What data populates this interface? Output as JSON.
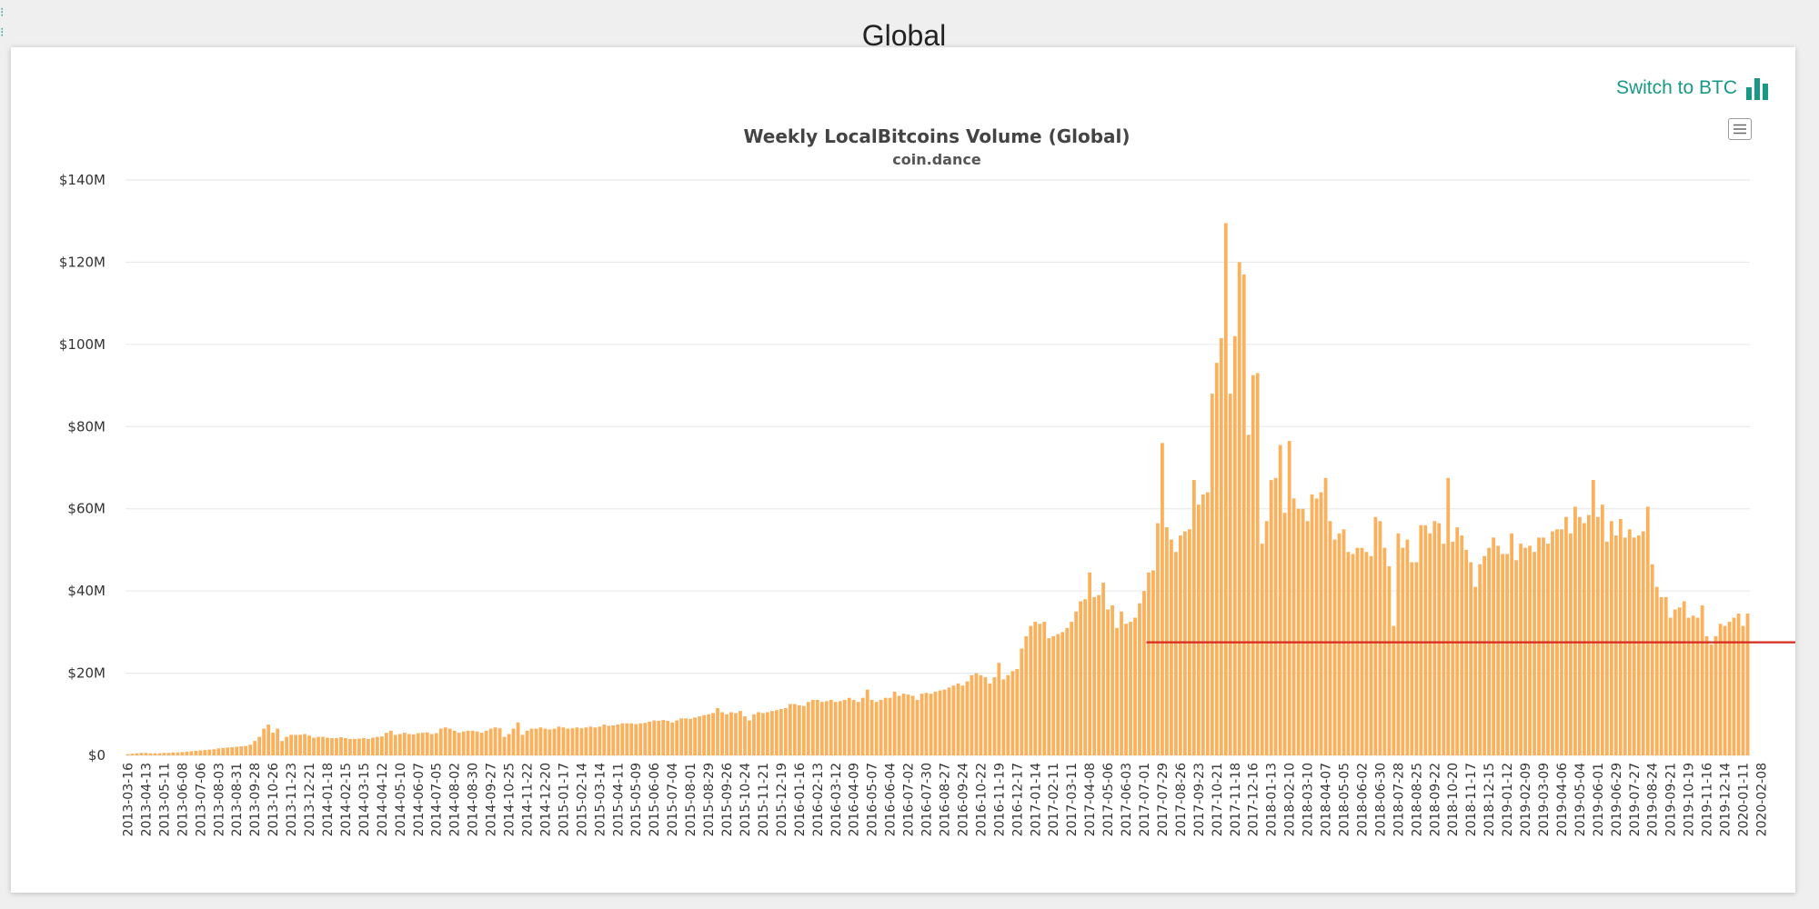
{
  "page": {
    "title": "Global"
  },
  "toolbar": {
    "switch_label": "Switch to BTC",
    "switch_icon": "bar-chart-icon",
    "menu_icon": "hamburger-menu-icon"
  },
  "colors": {
    "bars": "#fbb15c",
    "average_line": "#d62a1e",
    "accent": "#199985",
    "grid": "#e6e6e6"
  },
  "chart_data": {
    "type": "bar",
    "title": "Weekly LocalBitcoins Volume (Global)",
    "subtitle": "coin.dance",
    "xlabel": "",
    "ylabel": "",
    "ylim": [
      0,
      140
    ],
    "y_unit": "million USD",
    "y_ticks": [
      "$0",
      "$20M",
      "$40M",
      "$60M",
      "$80M",
      "$100M",
      "$120M",
      "$140M"
    ],
    "grid": true,
    "x_tick_labels": [
      "2013-03-16",
      "2013-04-13",
      "2013-05-11",
      "2013-06-08",
      "2013-07-06",
      "2013-08-03",
      "2013-08-31",
      "2013-09-28",
      "2013-10-26",
      "2013-11-23",
      "2013-12-21",
      "2014-01-18",
      "2014-02-15",
      "2014-03-15",
      "2014-04-12",
      "2014-05-10",
      "2014-06-07",
      "2014-07-05",
      "2014-08-02",
      "2014-08-30",
      "2014-09-27",
      "2014-10-25",
      "2014-11-22",
      "2014-12-20",
      "2015-01-17",
      "2015-02-14",
      "2015-03-14",
      "2015-04-11",
      "2015-05-09",
      "2015-06-06",
      "2015-07-04",
      "2015-08-01",
      "2015-08-29",
      "2015-09-26",
      "2015-10-24",
      "2015-11-21",
      "2015-12-19",
      "2016-01-16",
      "2016-02-13",
      "2016-03-12",
      "2016-04-09",
      "2016-05-07",
      "2016-06-04",
      "2016-07-02",
      "2016-07-30",
      "2016-08-27",
      "2016-09-24",
      "2016-10-22",
      "2016-11-19",
      "2016-12-17",
      "2017-01-14",
      "2017-02-11",
      "2017-03-11",
      "2017-04-08",
      "2017-05-06",
      "2017-06-03",
      "2017-07-01",
      "2017-07-29",
      "2017-08-26",
      "2017-09-23",
      "2017-10-21",
      "2017-11-18",
      "2017-12-16",
      "2018-01-13",
      "2018-02-10",
      "2018-03-10",
      "2018-04-07",
      "2018-05-05",
      "2018-06-02",
      "2018-06-30",
      "2018-07-28",
      "2018-08-25",
      "2018-09-22",
      "2018-10-20",
      "2018-11-17",
      "2018-12-15",
      "2019-01-12",
      "2019-02-09",
      "2019-03-09",
      "2019-04-06",
      "2019-05-04",
      "2019-06-01",
      "2019-06-29",
      "2019-07-27",
      "2019-08-24",
      "2019-09-21",
      "2019-10-19",
      "2019-11-16",
      "2019-12-14",
      "2020-01-11",
      "2020-02-08"
    ],
    "series": [
      {
        "values": [
          0.3,
          0.4,
          0.5,
          0.6,
          0.6,
          0.5,
          0.5,
          0.5,
          0.6,
          0.6,
          0.7,
          0.7,
          0.8,
          0.9,
          1.0,
          1.1,
          1.2,
          1.3,
          1.4,
          1.5,
          1.7,
          1.8,
          1.9,
          2.0,
          2.1,
          2.2,
          2.3,
          2.6,
          3.5,
          4.5,
          6.5,
          7.5,
          5.5,
          6.5,
          3.5,
          4.5,
          5.0,
          5.0,
          5.0,
          5.2,
          4.8,
          4.3,
          4.5,
          4.5,
          4.3,
          4.2,
          4.2,
          4.4,
          4.2,
          4.0,
          4.0,
          4.1,
          4.2,
          4.0,
          4.3,
          4.5,
          4.6,
          5.5,
          6.0,
          5.0,
          5.2,
          5.5,
          5.2,
          5.1,
          5.4,
          5.5,
          5.6,
          5.2,
          5.4,
          6.5,
          6.8,
          6.5,
          6.0,
          5.5,
          5.8,
          6.0,
          6.0,
          5.8,
          5.5,
          6.0,
          6.5,
          6.8,
          6.6,
          4.5,
          5.2,
          6.5,
          8.0,
          5.0,
          6.0,
          6.5,
          6.5,
          6.8,
          6.5,
          6.3,
          6.5,
          7.0,
          6.8,
          6.5,
          6.6,
          6.8,
          6.6,
          6.8,
          7.0,
          6.8,
          7.0,
          7.5,
          7.2,
          7.3,
          7.5,
          7.8,
          7.8,
          7.8,
          7.6,
          7.8,
          7.9,
          8.2,
          8.5,
          8.4,
          8.6,
          8.4,
          8.0,
          8.5,
          9.0,
          9.0,
          8.9,
          9.2,
          9.5,
          9.8,
          10.0,
          10.3,
          11.5,
          10.5,
          10.0,
          10.5,
          10.3,
          10.8,
          9.5,
          8.5,
          10.0,
          10.5,
          10.3,
          10.5,
          10.8,
          11.0,
          11.3,
          11.5,
          12.5,
          12.5,
          12.2,
          12.0,
          13.0,
          13.5,
          13.5,
          13.0,
          13.2,
          13.5,
          13.0,
          13.2,
          13.5,
          14.0,
          13.5,
          13.0,
          14.0,
          16.0,
          13.5,
          13.0,
          13.5,
          14.0,
          14.0,
          15.5,
          14.5,
          15.0,
          14.8,
          14.5,
          13.5,
          15.0,
          15.2,
          15.0,
          15.5,
          15.8,
          16.0,
          16.5,
          17.0,
          17.5,
          17.0,
          18.0,
          19.5,
          20.0,
          19.5,
          19.0,
          17.5,
          19.0,
          22.5,
          18.5,
          19.5,
          20.5,
          21.0,
          26.0,
          29.0,
          31.5,
          32.5,
          32.0,
          32.5,
          28.5,
          29.0,
          29.5,
          30.0,
          31.0,
          32.5,
          35.0,
          37.5,
          38.0,
          44.5,
          38.5,
          39.0,
          42.0,
          35.5,
          36.5,
          31.0,
          35.0,
          32.0,
          32.5,
          33.5,
          37.0,
          40.0,
          44.5,
          45.0,
          56.5,
          76.0,
          55.5,
          52.5,
          49.5,
          53.5,
          54.5,
          55.0,
          67.0,
          61.0,
          63.5,
          64.0,
          88.0,
          95.5,
          101.5,
          129.5,
          88.0,
          102.0,
          120.0,
          117.0,
          78.0,
          92.5,
          93.0,
          51.5,
          57.0,
          67.0,
          67.5,
          75.5,
          59.0,
          76.5,
          62.5,
          60.0,
          60.0,
          57.0,
          63.5,
          62.5,
          64.0,
          67.5,
          57.0,
          52.5,
          54.0,
          55.0,
          49.5,
          49.0,
          50.5,
          50.5,
          49.5,
          48.5,
          58.0,
          57.0,
          50.5,
          46.0,
          31.5,
          54.0,
          50.5,
          52.5,
          47.0,
          47.0,
          56.0,
          56.0,
          54.0,
          57.0,
          56.5,
          51.5,
          67.5,
          52.0,
          55.5,
          53.5,
          50.0,
          47.0,
          41.0,
          46.5,
          48.5,
          50.5,
          53.0,
          51.0,
          49.0,
          49.0,
          54.0,
          47.5,
          51.5,
          50.5,
          51.0,
          49.5,
          53.0,
          53.0,
          51.5,
          54.5,
          55.0,
          55.0,
          58.0,
          54.0,
          60.5,
          58.0,
          56.5,
          58.5,
          67.0,
          58.0,
          61.0,
          52.0,
          57.0,
          53.5,
          57.5,
          53.0,
          55.0,
          53.0,
          53.5,
          54.5,
          60.5,
          46.5,
          41.0,
          38.5,
          38.5,
          33.5,
          35.5,
          36.0,
          37.5,
          33.5,
          34.0,
          33.5,
          36.5,
          29.0,
          27.0,
          29.0,
          32.0,
          31.5,
          32.5,
          33.5,
          34.5,
          31.5,
          34.5
        ]
      }
    ],
    "average_line": {
      "value": 27.5,
      "from_week": 225,
      "to_week": 386
    }
  }
}
